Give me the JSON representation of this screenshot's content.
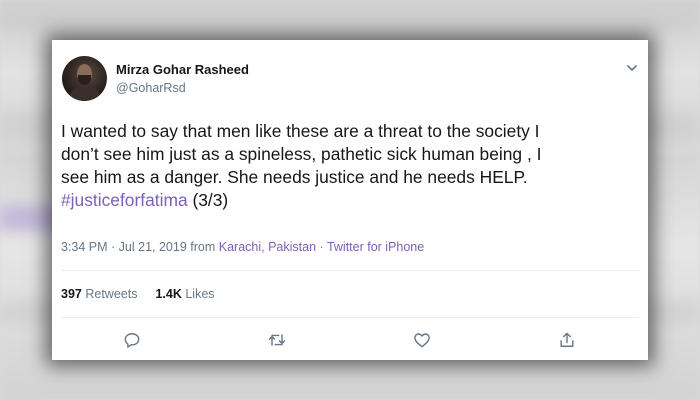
{
  "tweet": {
    "author_name": "Mirza Gohar Rasheed",
    "handle": "@GoharRsd",
    "text_line1": "I wanted to say that men like these are a threat to the society I",
    "text_line2": "don’t see him just as a spineless, pathetic sick human being , I",
    "text_line3": "see him as a danger. She needs justice and he needs HELP.",
    "hashtag": "#justiceforfatima",
    "thread_marker": "(3/3)",
    "time": "3:34 PM · Jul 21, 2019",
    "from_label": "from",
    "location": "Karachi, Pakistan",
    "separator": "·",
    "client": "Twitter for iPhone",
    "retweets_count": "397",
    "retweets_label": "Retweets",
    "likes_count": "1.4K",
    "likes_label": "Likes"
  },
  "icons": {
    "menu": "chevron-down-icon",
    "reply": "reply-icon",
    "retweet": "retweet-icon",
    "like": "heart-icon",
    "share": "share-icon"
  },
  "colors": {
    "link": "#7c5fb8",
    "secondary_text": "#657786",
    "primary_text": "#14171a"
  }
}
